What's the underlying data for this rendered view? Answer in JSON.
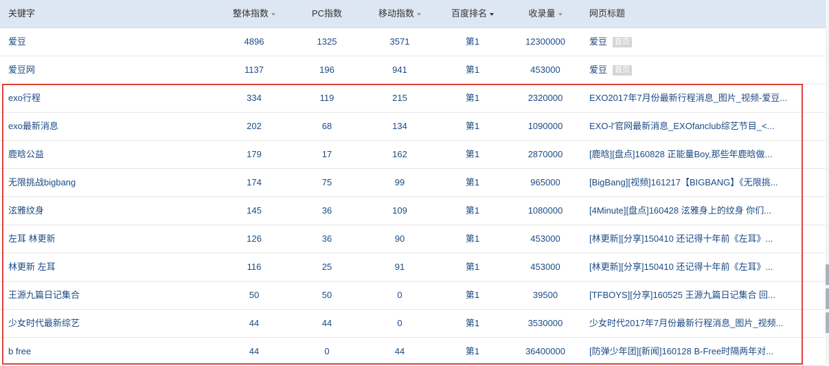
{
  "header": {
    "keyword": "关键字",
    "overall_index": "整体指数",
    "pc_index": "PC指数",
    "mobile_index": "移动指数",
    "baidu_rank": "百度排名",
    "indexed": "收录量",
    "page_title": "网页标题"
  },
  "rows": [
    {
      "keyword": "爱豆",
      "overall": "4896",
      "pc": "1325",
      "mobile": "3571",
      "rank": "第1",
      "indexed": "12300000",
      "title": "爱豆",
      "tag": "首页"
    },
    {
      "keyword": "爱豆网",
      "overall": "1137",
      "pc": "196",
      "mobile": "941",
      "rank": "第1",
      "indexed": "453000",
      "title": "爱豆",
      "tag": "首页"
    },
    {
      "keyword": "exo行程",
      "overall": "334",
      "pc": "119",
      "mobile": "215",
      "rank": "第1",
      "indexed": "2320000",
      "title": "EXO2017年7月份最新行程消息_图片_视频-爱豆...",
      "tag": ""
    },
    {
      "keyword": "exo最新消息",
      "overall": "202",
      "pc": "68",
      "mobile": "134",
      "rank": "第1",
      "indexed": "1090000",
      "title": "EXO-l'官网最新消息_EXOfanclub综艺节目_<...",
      "tag": ""
    },
    {
      "keyword": "鹿晗公益",
      "overall": "179",
      "pc": "17",
      "mobile": "162",
      "rank": "第1",
      "indexed": "2870000",
      "title": "[鹿晗][盘点]160828 正能量Boy,那些年鹿晗做...",
      "tag": ""
    },
    {
      "keyword": "无限挑战bigbang",
      "overall": "174",
      "pc": "75",
      "mobile": "99",
      "rank": "第1",
      "indexed": "965000",
      "title": "[BigBang][视频]161217【BIGBANG】《无限挑...",
      "tag": ""
    },
    {
      "keyword": "泫雅纹身",
      "overall": "145",
      "pc": "36",
      "mobile": "109",
      "rank": "第1",
      "indexed": "1080000",
      "title": "[4Minute][盘点]160428 泫雅身上的纹身 你们...",
      "tag": ""
    },
    {
      "keyword": "左耳 林更新",
      "overall": "126",
      "pc": "36",
      "mobile": "90",
      "rank": "第1",
      "indexed": "453000",
      "title": "[林更新][分享]150410 还记得十年前《左耳》...",
      "tag": ""
    },
    {
      "keyword": "林更新 左耳",
      "overall": "116",
      "pc": "25",
      "mobile": "91",
      "rank": "第1",
      "indexed": "453000",
      "title": "[林更新][分享]150410 还记得十年前《左耳》...",
      "tag": ""
    },
    {
      "keyword": "王源九篇日记集合",
      "overall": "50",
      "pc": "50",
      "mobile": "0",
      "rank": "第1",
      "indexed": "39500",
      "title": "[TFBOYS][分享]160525 王源九篇日记集合 回...",
      "tag": ""
    },
    {
      "keyword": "少女时代最新综艺",
      "overall": "44",
      "pc": "44",
      "mobile": "0",
      "rank": "第1",
      "indexed": "3530000",
      "title": "少女时代2017年7月份最新行程消息_图片_视频...",
      "tag": ""
    },
    {
      "keyword": "b free",
      "overall": "44",
      "pc": "0",
      "mobile": "44",
      "rank": "第1",
      "indexed": "36400000",
      "title": "[防弹少年团][新闻]160128 B-Free时隔两年对...",
      "tag": ""
    }
  ]
}
